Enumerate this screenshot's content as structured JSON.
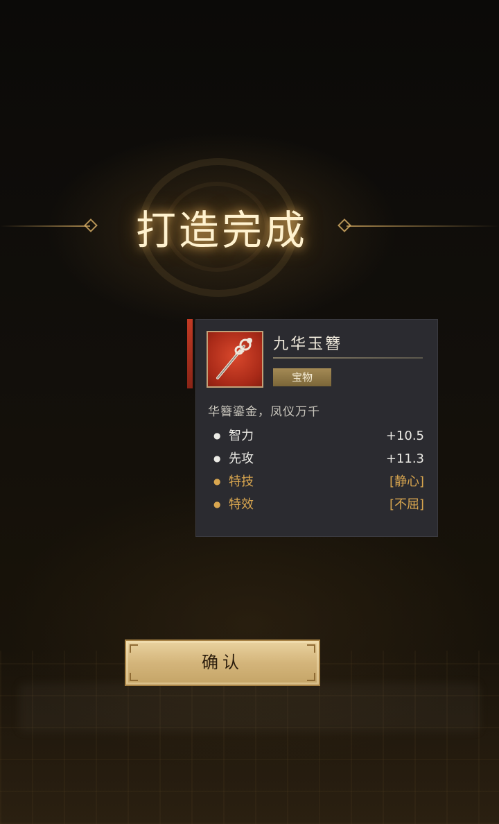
{
  "title": "打造完成",
  "item": {
    "name": "九华玉簪",
    "rarity": "宝物",
    "description": "华簪鎏金，凤仪万千",
    "icon": "hairpin-icon",
    "stats": [
      {
        "label": "智力",
        "value": "+10.5",
        "color": "#ecebe6"
      },
      {
        "label": "先攻",
        "value": "+11.3",
        "color": "#ecebe6"
      },
      {
        "label": "特技",
        "value": "[静心]",
        "color": "#d9a64f"
      },
      {
        "label": "特效",
        "value": "[不屈]",
        "color": "#d9a64f"
      }
    ]
  },
  "confirm_button": {
    "label": "确认"
  },
  "colors": {
    "accent_gold": "#d9a64f",
    "card_bg": "#2b2b30",
    "icon_bg": "#b8301c",
    "button_gold": "#d4b57b"
  }
}
